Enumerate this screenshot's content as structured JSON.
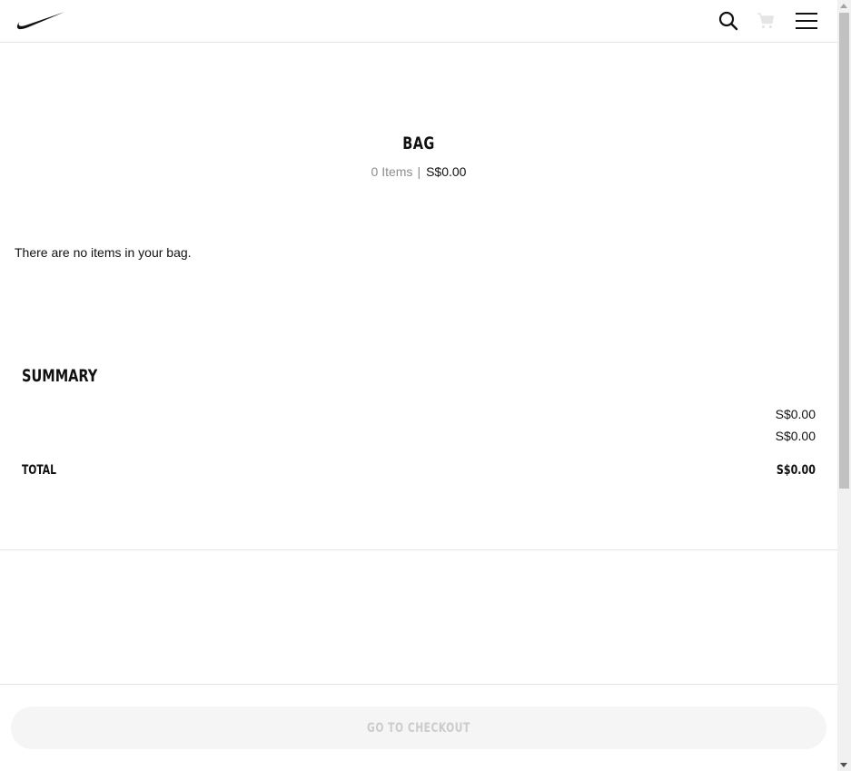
{
  "header": {
    "logo_icon": "nike-swoosh-icon",
    "search_icon": "search-icon",
    "cart_icon": "cart-icon",
    "menu_icon": "hamburger-menu-icon"
  },
  "bag": {
    "title": "BAG",
    "items_count": "0 Items",
    "separator": "|",
    "total": "S$0.00",
    "empty_message": "There are no items in your bag."
  },
  "summary": {
    "title": "SUMMARY",
    "subtotal_value": "S$0.00",
    "delivery_value": "S$0.00",
    "total_label": "TOTAL",
    "total_value": "S$0.00"
  },
  "footer": {
    "checkout_label": "GO TO CHECKOUT"
  },
  "colors": {
    "text_primary": "#111111",
    "text_muted": "#8d8d8d",
    "divider": "#e5e5e5",
    "button_disabled_bg": "#f5f5f5",
    "button_disabled_text": "#cccccc",
    "cart_icon_disabled": "#e5e5e5"
  }
}
